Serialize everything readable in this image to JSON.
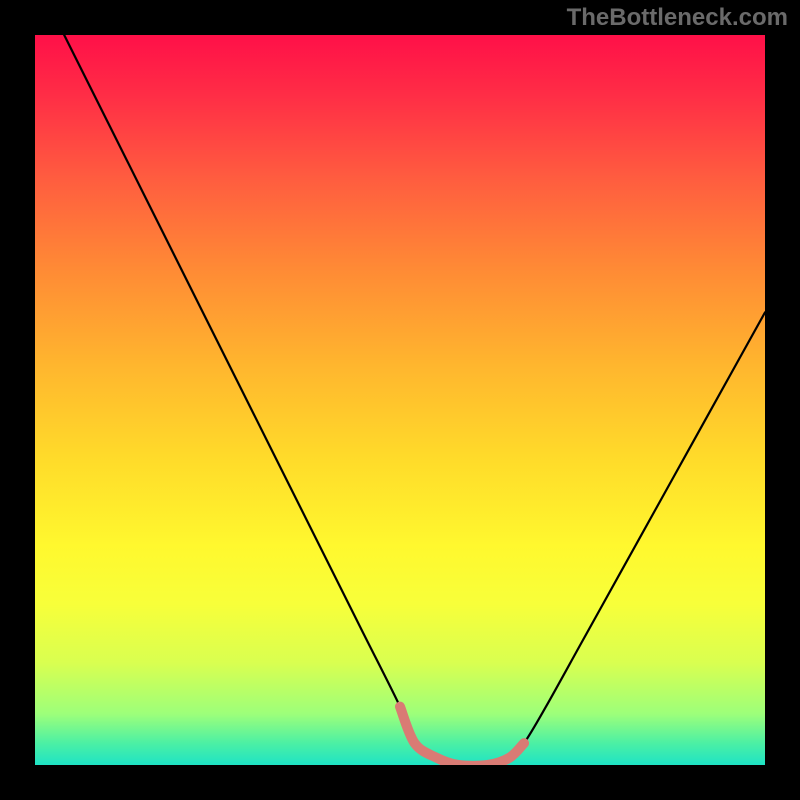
{
  "watermark": {
    "text": "TheBottleneck.com"
  },
  "chart_data": {
    "type": "line",
    "title": "",
    "xlabel": "",
    "ylabel": "",
    "xlim": [
      0,
      100
    ],
    "ylim": [
      0,
      100
    ],
    "series": [
      {
        "name": "bottleneck-curve",
        "color": "#000000",
        "x": [
          0,
          5,
          10,
          15,
          20,
          25,
          30,
          35,
          40,
          45,
          50,
          52,
          55,
          58,
          62,
          65,
          67,
          70,
          75,
          80,
          85,
          90,
          95,
          100
        ],
        "y": [
          108,
          98,
          88,
          78,
          68,
          58,
          48,
          38,
          28,
          18,
          8,
          3,
          1,
          0,
          0,
          1,
          3,
          8,
          17,
          26,
          35,
          44,
          53,
          62
        ]
      },
      {
        "name": "bottom-highlight",
        "color": "#d97b74",
        "x": [
          50,
          52,
          55,
          58,
          62,
          65,
          67
        ],
        "y": [
          8,
          3,
          1,
          0,
          0,
          1,
          3
        ]
      }
    ],
    "gradient_stops": [
      {
        "pos": 0,
        "color": "#ff1048"
      },
      {
        "pos": 8,
        "color": "#ff2c46"
      },
      {
        "pos": 20,
        "color": "#ff5e3f"
      },
      {
        "pos": 32,
        "color": "#ff8a35"
      },
      {
        "pos": 45,
        "color": "#ffb52e"
      },
      {
        "pos": 58,
        "color": "#ffdb2a"
      },
      {
        "pos": 70,
        "color": "#fff82e"
      },
      {
        "pos": 78,
        "color": "#f7ff3a"
      },
      {
        "pos": 86,
        "color": "#d9ff50"
      },
      {
        "pos": 93,
        "color": "#9dff7a"
      },
      {
        "pos": 97,
        "color": "#4cf0a4"
      },
      {
        "pos": 100,
        "color": "#1ee3c5"
      }
    ]
  }
}
